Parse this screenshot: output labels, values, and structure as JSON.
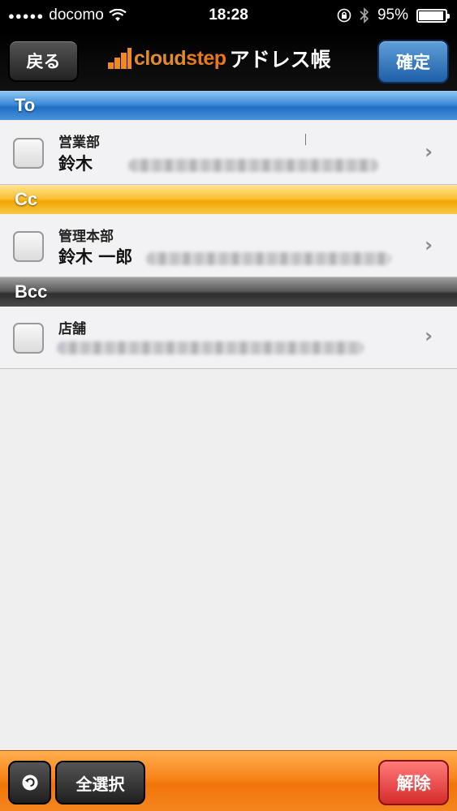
{
  "status_bar": {
    "carrier": "docomo",
    "time": "18:28",
    "battery_percent": "95%",
    "battery_level": 0.95,
    "icons": [
      "signal-dots-icon",
      "wifi-icon",
      "orientation-lock-icon",
      "bluetooth-icon",
      "battery-icon"
    ]
  },
  "navbar": {
    "back_label": "戻る",
    "logo_text_cloud": "cloud",
    "logo_text_step": "step",
    "title": "アドレス帳",
    "confirm_label": "確定"
  },
  "sections": [
    {
      "label": "To"
    },
    {
      "label": "Cc"
    },
    {
      "label": "Bcc"
    }
  ],
  "contacts": [
    {
      "department": "営業部",
      "name": "鈴木",
      "checked": false
    },
    {
      "department": "管理本部",
      "name": "鈴木 一郎",
      "checked": false
    },
    {
      "department": "店舗",
      "name": "",
      "checked": false
    }
  ],
  "toolbar": {
    "undo_icon": "undo-icon",
    "select_all_label": "全選択",
    "release_label": "解除"
  },
  "colors": {
    "to_header": "#2f7fd2",
    "cc_header": "#f5b41c",
    "bcc_header": "#3c3c3c",
    "toolbar": "#f58218",
    "confirm_button": "#2a6cb5",
    "release_button": "#e04040",
    "logo_orange": "#e8781a"
  }
}
